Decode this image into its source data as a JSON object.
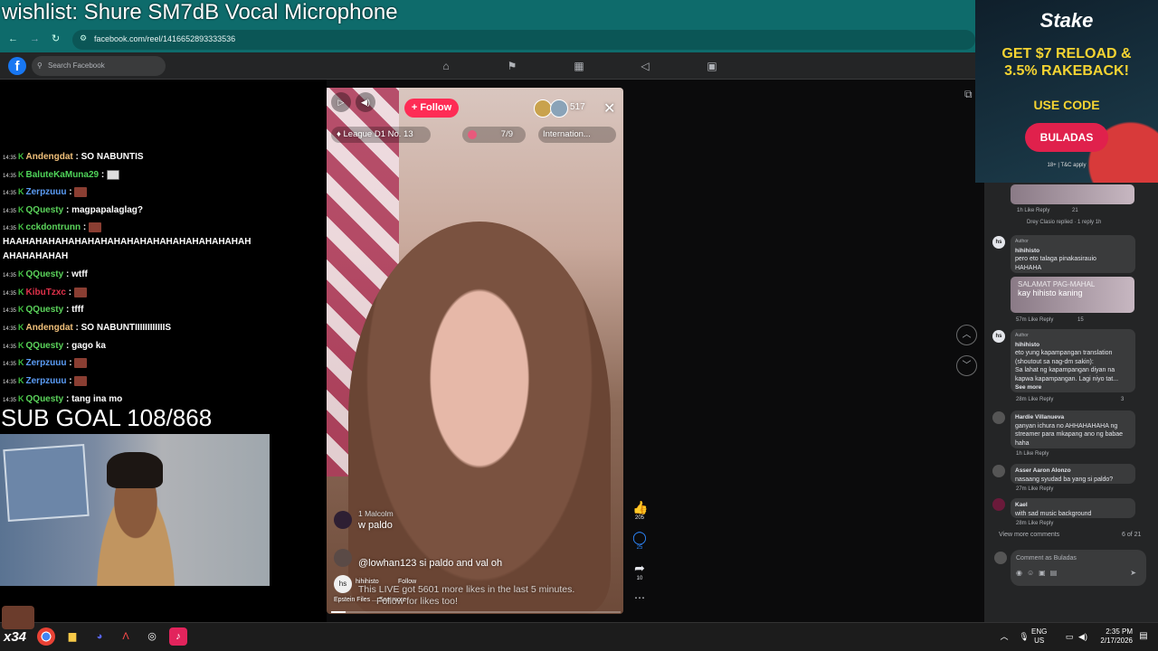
{
  "overlay": {
    "title": "wishlist: Shure SM7dB Vocal Microphone",
    "sub_goal": "SUB GOAL 108/868",
    "badge": "x34"
  },
  "browser": {
    "url": "facebook.com/reel/1416652893333536"
  },
  "fb": {
    "search_placeholder": "Search Facebook",
    "logo_letter": "f"
  },
  "chat": [
    {
      "time": "14:35",
      "name": "Andengdat",
      "color": "#f0c07a",
      "msg": "SO NABUNTIS"
    },
    {
      "time": "14:35",
      "name": "BaluteKaMuna29",
      "color": "#4fd45a",
      "msg": ""
    },
    {
      "time": "14:35",
      "name": "Zerpzuuu",
      "color": "#5b9cf5",
      "msg": ""
    },
    {
      "time": "14:35",
      "name": "QQuesty",
      "color": "#5bd45b",
      "msg": "magpapalaglag?"
    },
    {
      "time": "14:35",
      "name": "cckdontrunn",
      "color": "#5bd45b",
      "msg": ""
    },
    {
      "time": "",
      "name": "",
      "color": "#fff",
      "msg": "HAAHAHAHAHAHAHAHAHAHAHAHAHAHAHAHAHAHAH"
    },
    {
      "time": "",
      "name": "",
      "color": "#fff",
      "msg": "AHAHAHAHAH"
    },
    {
      "time": "14:35",
      "name": "QQuesty",
      "color": "#5bd45b",
      "msg": "wtff"
    },
    {
      "time": "14:35",
      "name": "KibuTzxc",
      "color": "#e0314a",
      "msg": ""
    },
    {
      "time": "14:35",
      "name": "QQuesty",
      "color": "#5bd45b",
      "msg": "tfff"
    },
    {
      "time": "14:35",
      "name": "Andengdat",
      "color": "#f0c07a",
      "msg": "SO NABUNTIIIIIIIIIIIIS"
    },
    {
      "time": "14:35",
      "name": "QQuesty",
      "color": "#5bd45b",
      "msg": "gago ka"
    },
    {
      "time": "14:35",
      "name": "Zerpzuuu",
      "color": "#5b9cf5",
      "msg": ""
    },
    {
      "time": "14:35",
      "name": "Zerpzuuu",
      "color": "#5b9cf5",
      "msg": ""
    },
    {
      "time": "14:35",
      "name": "QQuesty",
      "color": "#5bd45b",
      "msg": "tang ina mo"
    }
  ],
  "reel": {
    "follow_label": "+ Follow",
    "viewers": "517",
    "league": "League D1 No. 13",
    "rank": "7/9",
    "intl": "Internation...",
    "comment1_user": "1 Malcolm",
    "comment1_text": "w paldo",
    "comment2_text": "@lowhan123 si paldo and val oh",
    "author": "hihihisto",
    "author_follow": "Follow",
    "author_sub": "Epstein Files ... See more",
    "live_info_1": "This LIVE got 5601 more likes in the last 5 minutes.",
    "live_info_2": "Follow for likes too!",
    "progress": 0.05
  },
  "side_actions": {
    "likes": "205",
    "comments": "25",
    "shares": "10"
  },
  "ad": {
    "logo": "Stake",
    "headline_1": "GET $7 RELOAD &",
    "headline_2": "3.5% RAKEBACK!",
    "use_code": "USE CODE",
    "code": "BULADAS",
    "terms": "18+ | T&C apply"
  },
  "comments_panel": {
    "top_meta": "1h   Like   Reply",
    "top_count": "21",
    "replied_line": "Drey Clasio replied · 1 reply 1h",
    "c1_author_tag": "Author",
    "c1_name": "hihihisto",
    "c1_text_1": "pero eto talaga pinakasirauio",
    "c1_text_2": "HAHAHA",
    "c1_img_text_1": "SALAMAT PAG-MAHAL",
    "c1_img_text_2": "kay hihisto kaning",
    "c1_meta": "57m   Like   Reply",
    "c1_count": "15",
    "c2_author_tag": "Author",
    "c2_name": "hihihisto",
    "c2_text_1": "eto yung kapampangan translation",
    "c2_text_2": "(shoutout sa nag-dm sakin):",
    "c2_text_3": "Sa lahat ng kapampangan diyan na",
    "c2_text_4": "kapwa kapampangan. Lagi niyo tat...",
    "c2_see_more": "See more",
    "c2_meta": "28m   Like   Reply",
    "c2_count": "3",
    "c3_name": "Hardie Villanueva",
    "c3_text_1": "ganyan ichura no AHHAHAHAHA ng",
    "c3_text_2": "streamer para mkapang ano ng babae",
    "c3_text_3": "haha",
    "c3_meta": "1h   Like   Reply",
    "c4_name": "Asser Aaron Alonzo",
    "c4_text": "nasaang syudad ba yang si paldo?",
    "c4_meta": "27m   Like   Reply",
    "c5_name": "Kael",
    "c5_text": "with sad music background",
    "c5_meta": "28m   Like   Reply",
    "view_more": "View more comments",
    "page_count": "6 of 21",
    "comment_placeholder": "Comment as Buladas"
  },
  "taskbar": {
    "lang_1": "ENG",
    "lang_2": "US",
    "time": "2:35 PM",
    "date": "2/17/2026"
  }
}
